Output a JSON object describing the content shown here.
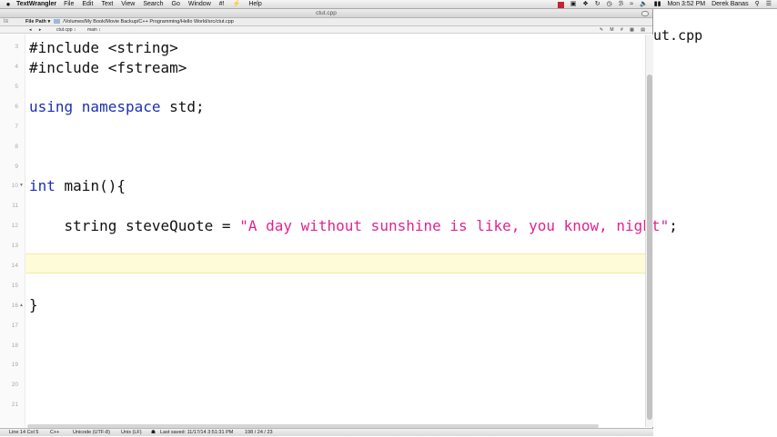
{
  "menubar": {
    "apple": "",
    "app": "TextWrangler",
    "menus": [
      "File",
      "Edit",
      "Text",
      "View",
      "Search",
      "Go",
      "Window",
      "#!",
      "Help"
    ],
    "clock": "Mon 3:52 PM",
    "user": "Derek Banas"
  },
  "window": {
    "title": "ctut.cpp",
    "path_label": "File Path ▾",
    "path": "/Volumes/My Book/Movie Backup/C++ Programming/Hello World/src/ctut.cpp",
    "nav_back": "◂",
    "nav_forward": "▸",
    "file_menu": "ctut.cpp",
    "function_menu": "main"
  },
  "editor": {
    "line_numbers": [
      "3",
      "4",
      "5",
      "6",
      "7",
      "8",
      "9",
      "10",
      "11",
      "12",
      "13",
      "14",
      "15",
      "16",
      "17",
      "18",
      "19",
      "20",
      "21"
    ],
    "lines": {
      "l3": "#include <string>",
      "l4": "#include <fstream>",
      "l6_kw": "using namespace",
      "l6_rest": " std;",
      "l10_kw": "int",
      "l10_rest": " main(){",
      "l12_pre": "    string steveQuote = ",
      "l12_str": "\"A day without sunshine is like, you know, night\"",
      "l12_post": ";",
      "l16": "}"
    },
    "current_line": "14"
  },
  "statusbar": {
    "position": "Line 14 Col 5",
    "language": "C++",
    "encoding": "Unicode (UTF-8)",
    "line_endings": "Unix (LF)",
    "saved": "Last saved: 11/17/14 3:51:31 PM",
    "counts": "198 / 24 / 23"
  },
  "background_window": {
    "text": "ut.cpp"
  }
}
